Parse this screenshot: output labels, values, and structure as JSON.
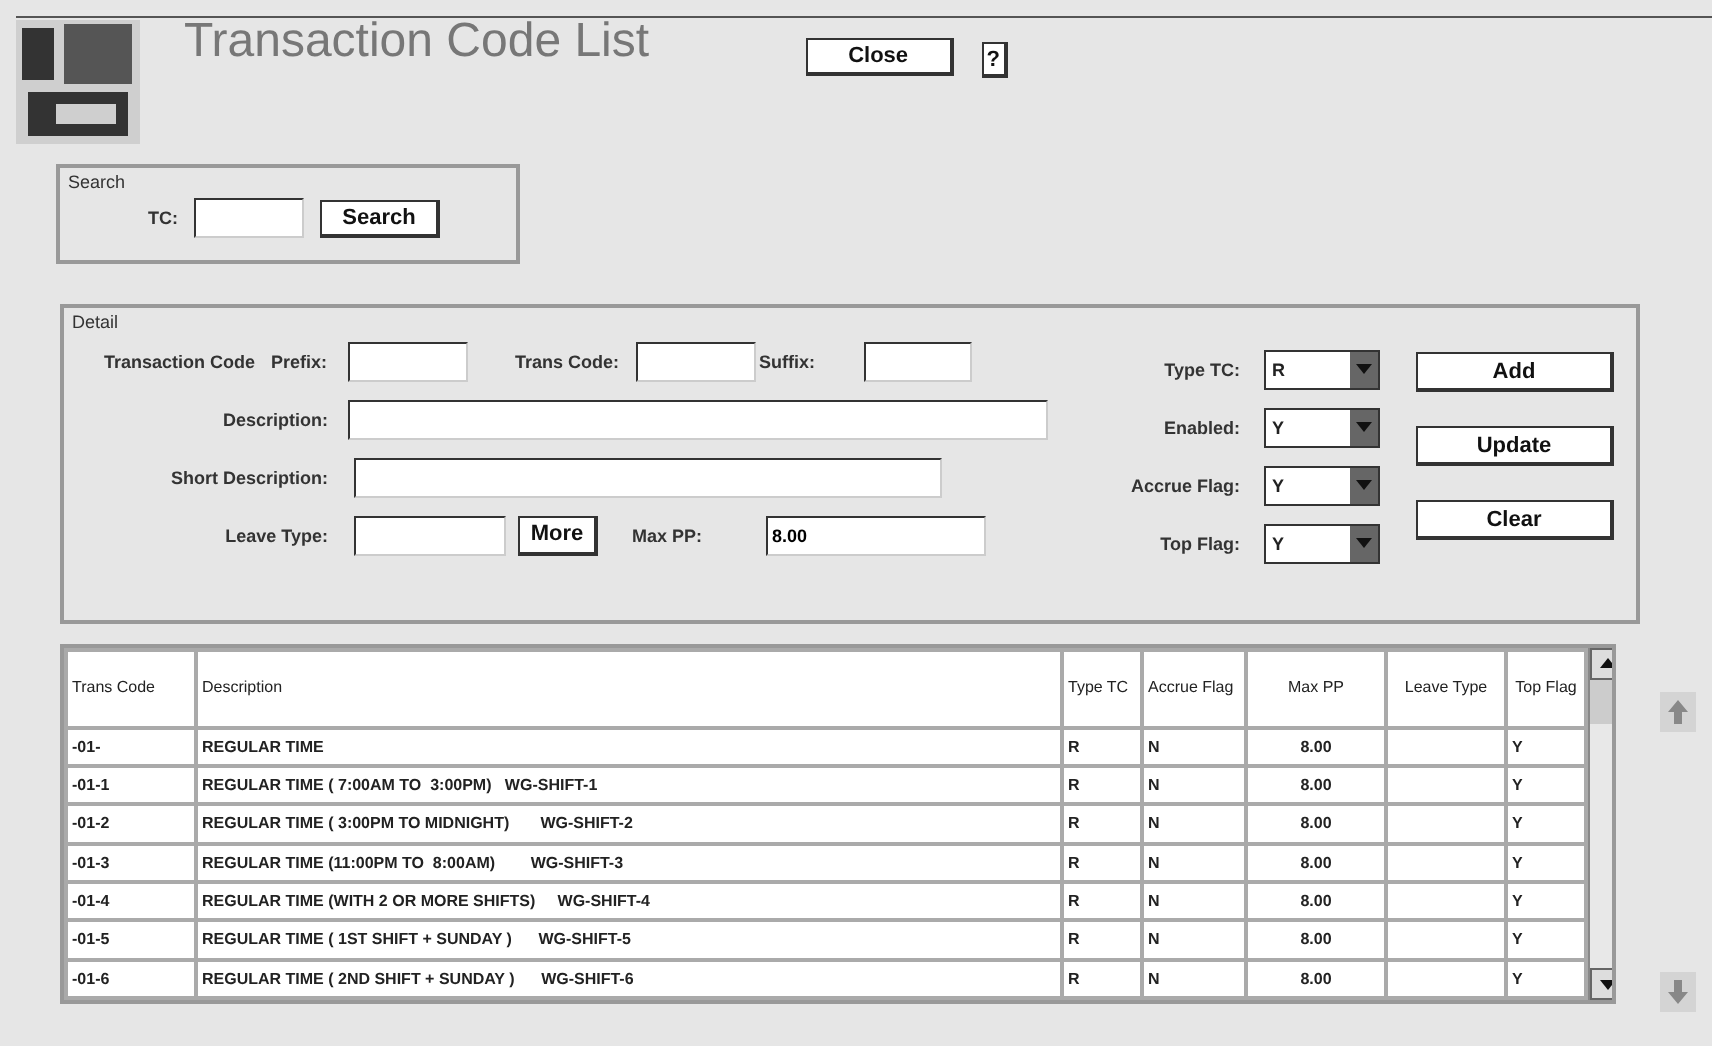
{
  "header": {
    "title": "Transaction Code List",
    "close_button": "Close",
    "help_button": "?"
  },
  "search": {
    "legend": "Search",
    "label": "TC:",
    "button": "Search"
  },
  "detail": {
    "legend": "Detail",
    "transaction_code_label": "Transaction Code",
    "prefix_label": "Prefix:",
    "trans_code_label": "Trans Code:",
    "suffix_label": "Suffix:",
    "description_label": "Description:",
    "short_description_label": "Short Description:",
    "leave_type_label": "Leave Type:",
    "more_button": "More",
    "max_pp_label": "Max PP:",
    "max_pp_value": "8.00",
    "dropdowns": [
      {
        "label": "Type TC:",
        "value": "R"
      },
      {
        "label": "Enabled:",
        "value": "Y"
      },
      {
        "label": "Accrue Flag:",
        "value": "Y"
      },
      {
        "label": "Top Flag:",
        "value": "Y"
      }
    ],
    "buttons": [
      "Add",
      "Update",
      "Clear"
    ]
  },
  "table": {
    "columns": [
      "Trans Code",
      "Description",
      "Type TC",
      "Accrue Flag",
      "Max PP",
      "Leave Type",
      "Top Flag"
    ],
    "rows": [
      [
        "-01-",
        "REGULAR TIME",
        "R",
        "N",
        "8.00",
        "",
        "Y"
      ],
      [
        "-01-1",
        "REGULAR TIME ( 7:00AM TO  3:00PM)   WG-SHIFT-1",
        "R",
        "N",
        "8.00",
        "",
        "Y"
      ],
      [
        "-01-2",
        "REGULAR TIME ( 3:00PM TO MIDNIGHT)       WG-SHIFT-2",
        "R",
        "N",
        "8.00",
        "",
        "Y"
      ],
      [
        "-01-3",
        "REGULAR TIME (11:00PM TO  8:00AM)        WG-SHIFT-3",
        "R",
        "N",
        "8.00",
        "",
        "Y"
      ],
      [
        "-01-4",
        "REGULAR TIME (WITH 2 OR MORE SHIFTS)     WG-SHIFT-4",
        "R",
        "N",
        "8.00",
        "",
        "Y"
      ],
      [
        "-01-5",
        "REGULAR TIME ( 1ST SHIFT + SUNDAY )      WG-SHIFT-5",
        "R",
        "N",
        "8.00",
        "",
        "Y"
      ],
      [
        "-01-6",
        "REGULAR TIME ( 2ND SHIFT + SUNDAY )      WG-SHIFT-6",
        "R",
        "N",
        "8.00",
        "",
        "Y"
      ]
    ]
  }
}
